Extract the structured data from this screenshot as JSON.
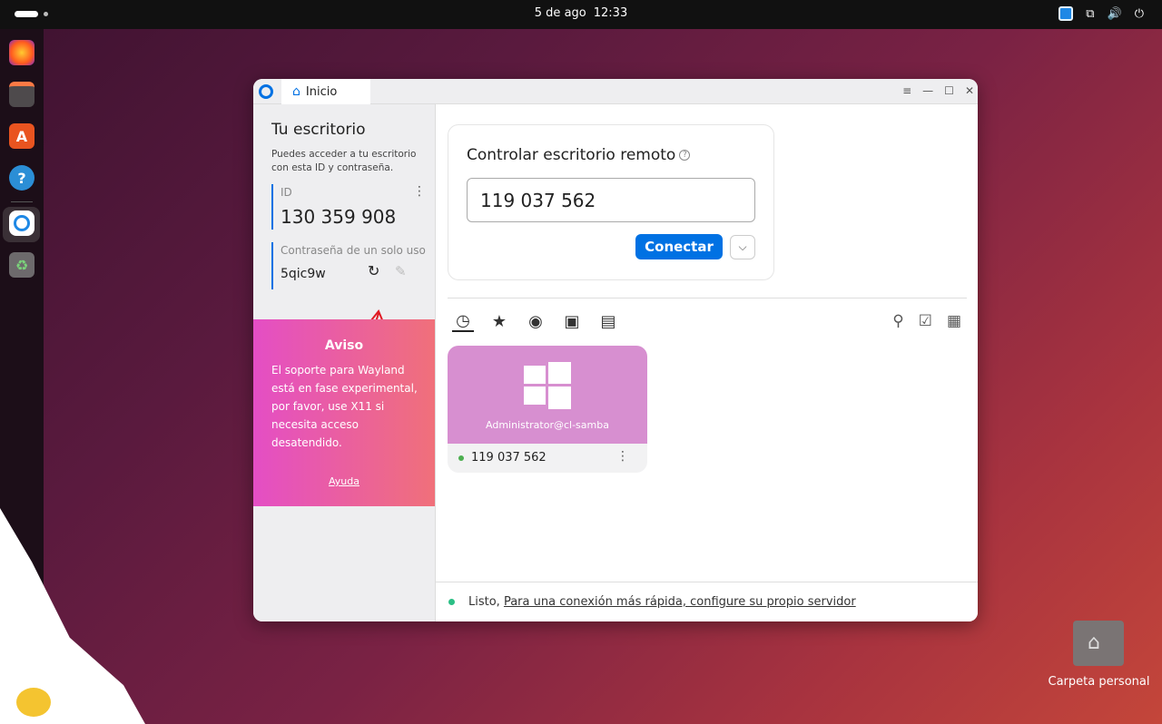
{
  "topbar": {
    "date": "5 de ago",
    "time": "12:33"
  },
  "window": {
    "tab_label": "Inicio",
    "left": {
      "title": "Tu escritorio",
      "description": "Puedes acceder a tu escritorio con esta ID y contraseña.",
      "id_label": "ID",
      "id_value": "130 359 908",
      "password_label": "Contraseña de un solo uso",
      "password_value": "5qic9w",
      "notice": {
        "title": "Aviso",
        "body": "El soporte para Wayland está en fase experimental, por favor, use X11 si necesita acceso desatendido.",
        "help": "Ayuda"
      }
    },
    "main": {
      "control_title": "Controlar escritorio remoto",
      "remote_id_value": "119 037 562",
      "connect_label": "Conectar",
      "peer_card": {
        "user": "Administrator@cl-samba",
        "id": "119 037 562"
      },
      "status": {
        "text": "Listo,",
        "link": "Para una conexión más rápida, configure su propio servidor"
      }
    }
  },
  "desktop": {
    "folder_label": "Carpeta personal"
  },
  "colors": {
    "accent": "#0071e3",
    "notice_start": "#e44ec5",
    "notice_end": "#f0707a",
    "card_top": "#d78fd0",
    "status_dot": "#2bbf85"
  },
  "icons": [
    "firefox-icon",
    "files-icon",
    "app-center-icon",
    "help-icon",
    "rustdesk-icon",
    "trash-icon",
    "network-icon",
    "volume-icon",
    "power-icon",
    "history-icon",
    "star-icon",
    "compass-icon",
    "address-book-icon",
    "devices-icon",
    "search-icon",
    "checkbox-icon",
    "grid-icon",
    "windows-icon",
    "home-icon"
  ]
}
